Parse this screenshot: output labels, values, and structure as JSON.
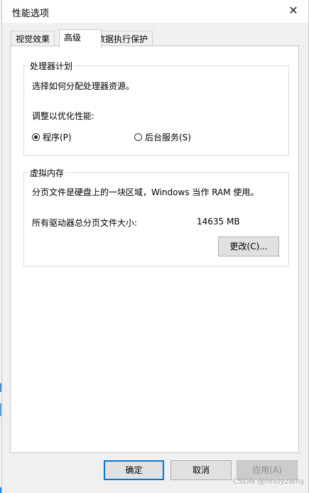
{
  "window": {
    "title": "性能选项",
    "close_glyph": "✕"
  },
  "tabs": [
    {
      "label": "视觉效果"
    },
    {
      "label": "高级"
    },
    {
      "label": "数据执行保护"
    }
  ],
  "processor": {
    "legend": "处理器计划",
    "description": "选择如何分配处理器资源。",
    "adjust_label": "调整以优化性能:",
    "options": [
      {
        "label": "程序(P)",
        "selected": true
      },
      {
        "label": "后台服务(S)",
        "selected": false
      }
    ]
  },
  "virtual_memory": {
    "legend": "虚拟内存",
    "description": "分页文件是硬盘上的一块区域，Windows 当作 RAM 使用。",
    "total_label": "所有驱动器总分页文件大小:",
    "total_value": "14635 MB",
    "change_button": "更改(C)..."
  },
  "footer": {
    "ok": "确定",
    "cancel": "取消",
    "apply": "应用(A)"
  },
  "watermark": "CSDN @hhdyzwhy",
  "colors": {
    "accent": "#0078d7"
  }
}
